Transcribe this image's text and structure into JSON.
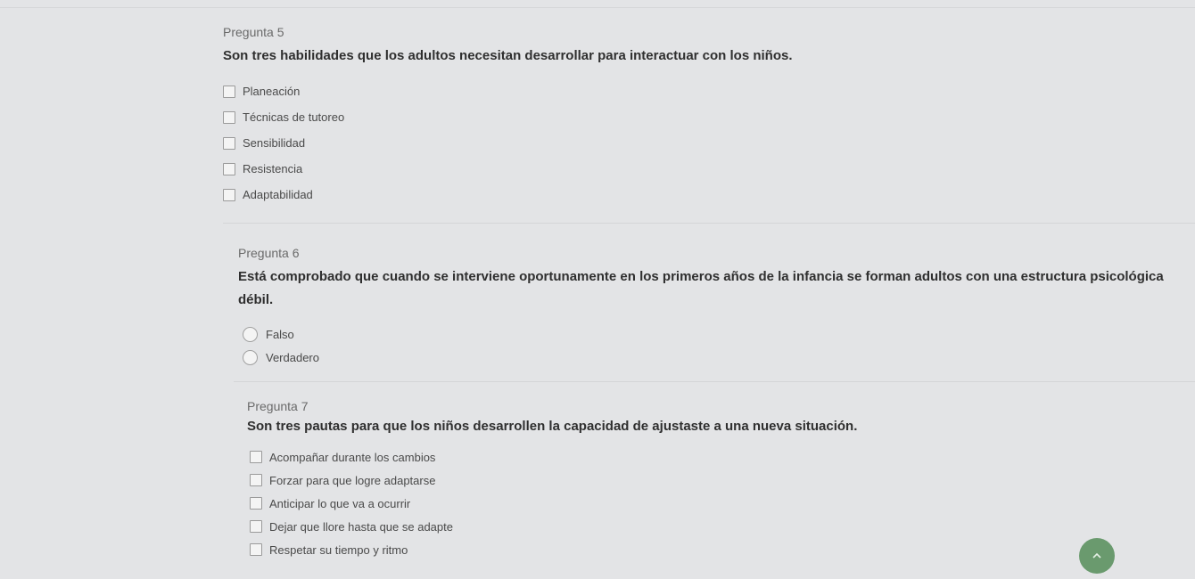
{
  "questions": [
    {
      "number": "Pregunta 5",
      "text": "Son tres habilidades que los adultos necesitan desarrollar para interactuar con los niños.",
      "type": "checkbox",
      "options": [
        "Planeación",
        "Técnicas de tutoreo",
        "Sensibilidad",
        "Resistencia",
        "Adaptabilidad"
      ]
    },
    {
      "number": "Pregunta 6",
      "text": "Está comprobado que cuando se interviene oportunamente en los primeros años de la infancia se forman adultos con una estructura psicológica débil.",
      "type": "radio",
      "options": [
        "Falso",
        "Verdadero"
      ]
    },
    {
      "number": "Pregunta 7",
      "text": "Son tres pautas para que los niños desarrollen la capacidad de ajustaste a una nueva situación.",
      "type": "checkbox",
      "options": [
        "Acompañar durante los cambios",
        "Forzar para que logre adaptarse",
        "Anticipar lo que va a ocurrir",
        "Dejar que llore hasta que se adapte",
        "Respetar su tiempo y ritmo"
      ]
    }
  ],
  "scroll_top_icon": "chevron-up-icon",
  "colors": {
    "accent": "#6a9a6e"
  }
}
